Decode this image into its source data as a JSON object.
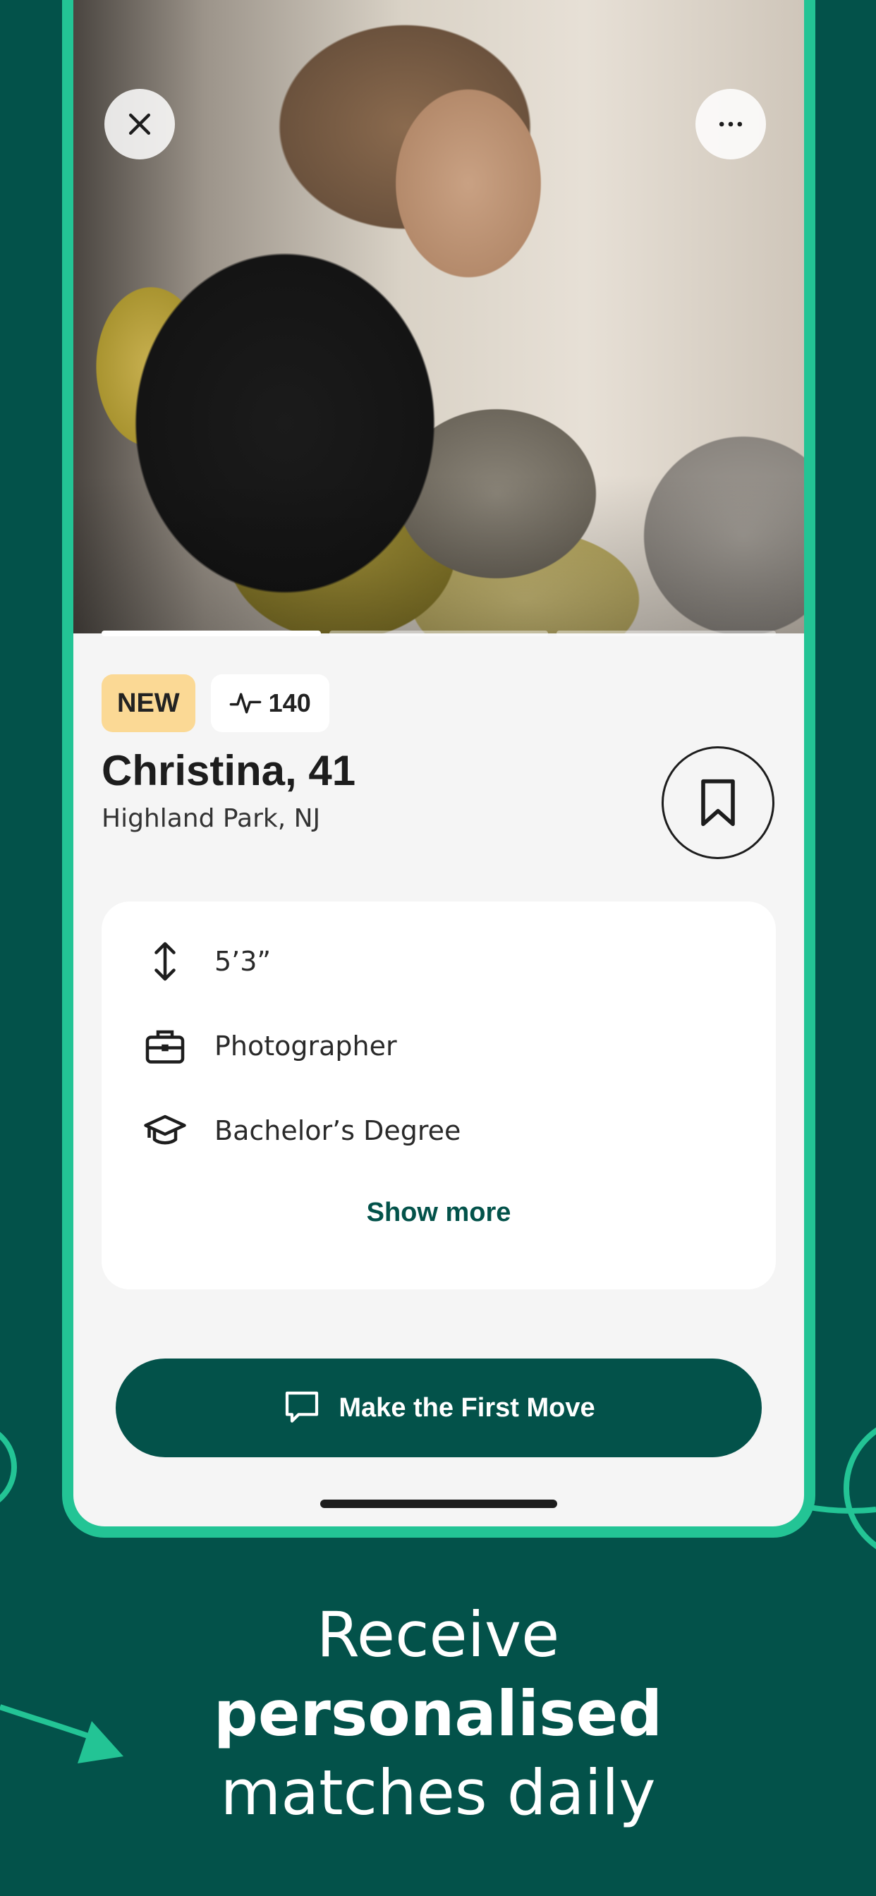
{
  "profile": {
    "badge_new": "NEW",
    "score": "140",
    "name_age": "Christina, 41",
    "location": "Highland Park, NJ",
    "photo_count": 3,
    "active_photo": 1
  },
  "details": {
    "height": "5’3”",
    "job": "Photographer",
    "education": "Bachelor’s Degree",
    "show_more": "Show more"
  },
  "cta": {
    "label": "Make the First Move"
  },
  "tagline": {
    "line1": "Receive",
    "line2": "personalised",
    "line3": "matches daily"
  },
  "colors": {
    "background": "#03524a",
    "accent": "#23c495",
    "badge_new": "#fbd995",
    "card": "#ffffff"
  },
  "icons": {
    "close": "close-icon",
    "more": "more-icon",
    "activity": "activity-icon",
    "bookmark": "bookmark-icon",
    "height": "height-arrows-icon",
    "job": "briefcase-icon",
    "education": "graduation-cap-icon",
    "message": "chat-bubble-icon"
  }
}
